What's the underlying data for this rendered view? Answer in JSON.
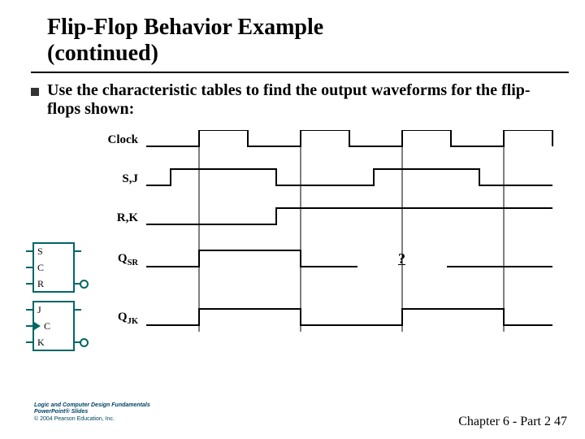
{
  "title_line1": "Flip-Flop Behavior Example",
  "title_line2": "(continued)",
  "bullet": "Use the characteristic tables to find the output waveforms for the flip-flops shown:",
  "signals": {
    "clock": "Clock",
    "sj": "S,J",
    "rk": "R,K",
    "qsr": "Q",
    "qsr_sub": "SR",
    "qjk": "Q",
    "qjk_sub": "JK"
  },
  "ff1": {
    "p1": "S",
    "p2": "C",
    "p3": "R"
  },
  "ff2": {
    "p1": "J",
    "p2": "C",
    "p3": "K"
  },
  "qmark": "?",
  "footer_logo_l1": "Logic and Computer Design Fundamentals",
  "footer_logo_l2": "PowerPoint® Slides",
  "footer_logo_l3": "© 2004 Pearson Education, Inc.",
  "footer_right": "Chapter 6 - Part 2    47",
  "chart_data": {
    "type": "timing-diagram",
    "x_range": [
      0,
      500
    ],
    "grid_x": [
      65,
      190,
      315,
      440
    ],
    "signals": [
      {
        "name": "Clock",
        "edges": [
          [
            0,
            0
          ],
          [
            65,
            1
          ],
          [
            125,
            0
          ],
          [
            190,
            1
          ],
          [
            250,
            0
          ],
          [
            315,
            1
          ],
          [
            375,
            0
          ],
          [
            440,
            1
          ],
          [
            500,
            0
          ]
        ]
      },
      {
        "name": "S,J",
        "edges": [
          [
            0,
            0
          ],
          [
            30,
            1
          ],
          [
            160,
            0
          ],
          [
            280,
            1
          ],
          [
            410,
            0
          ]
        ]
      },
      {
        "name": "R,K",
        "edges": [
          [
            0,
            0
          ],
          [
            160,
            1
          ],
          [
            500,
            1
          ]
        ]
      },
      {
        "name": "QSR",
        "edges": [
          [
            0,
            0
          ],
          [
            65,
            1
          ],
          [
            190,
            0
          ],
          [
            315,
            "?"
          ],
          [
            500,
            "?"
          ]
        ]
      },
      {
        "name": "QJK",
        "edges": [
          [
            0,
            0
          ],
          [
            65,
            1
          ],
          [
            190,
            0
          ],
          [
            315,
            1
          ],
          [
            440,
            0
          ]
        ]
      }
    ]
  }
}
